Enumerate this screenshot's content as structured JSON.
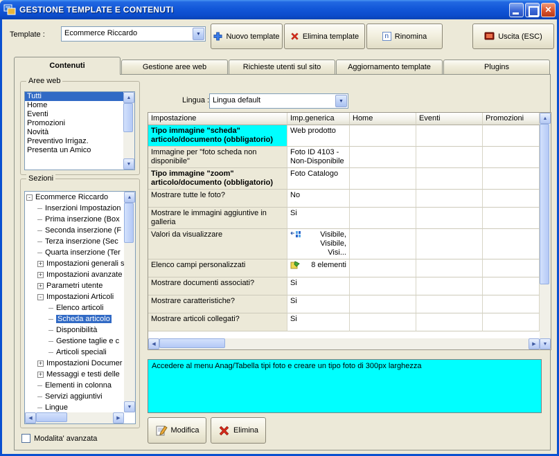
{
  "window": {
    "title": "GESTIONE TEMPLATE E CONTENUTI"
  },
  "toolbar": {
    "template_label": "Template :",
    "template_value": "Ecommerce Riccardo",
    "buttons": {
      "nuovo": "Nuovo template",
      "elimina": "Elimina template",
      "rinomina": "Rinomina",
      "rinomina_icon_letter": "n",
      "uscita": "Uscita (ESC)"
    }
  },
  "tabs": [
    {
      "label": "Contenuti",
      "active": true
    },
    {
      "label": "Gestione aree web"
    },
    {
      "label": "Richieste utenti sul sito"
    },
    {
      "label": "Aggiornamento template"
    },
    {
      "label": "Plugins"
    }
  ],
  "aree_web": {
    "title": "Aree web",
    "selected_index": 0,
    "items": [
      "Tutti",
      "Home",
      "Eventi",
      "Promozioni",
      "Novità",
      "Preventivo Irrigaz.",
      "Presenta un Amico"
    ]
  },
  "sezioni": {
    "title": "Sezioni",
    "items": [
      {
        "label": "Ecommerce Riccardo",
        "level": 0,
        "expander": "minus"
      },
      {
        "label": "Inserzioni Impostazion",
        "level": 1
      },
      {
        "label": "Prima inserzione (Box",
        "level": 1
      },
      {
        "label": "Seconda inserzione (F",
        "level": 1
      },
      {
        "label": "Terza inserzione (Sec",
        "level": 1
      },
      {
        "label": "Quarta inserzione (Ter",
        "level": 1
      },
      {
        "label": "Impostazioni generali s",
        "level": 1,
        "expander": "plus"
      },
      {
        "label": "Impostazioni avanzate",
        "level": 1,
        "expander": "plus"
      },
      {
        "label": "Parametri utente",
        "level": 1,
        "expander": "plus"
      },
      {
        "label": "Impostazioni Articoli",
        "level": 1,
        "expander": "minus"
      },
      {
        "label": "Elenco articoli",
        "level": 2
      },
      {
        "label": "Scheda articolo",
        "level": 2,
        "selected": true
      },
      {
        "label": "Disponibilità",
        "level": 2
      },
      {
        "label": "Gestione taglie e c",
        "level": 2
      },
      {
        "label": "Articoli speciali",
        "level": 2
      },
      {
        "label": "Impostazioni Documer",
        "level": 1,
        "expander": "plus"
      },
      {
        "label": "Messaggi e testi delle",
        "level": 1,
        "expander": "plus"
      },
      {
        "label": "Elementi in colonna",
        "level": 1
      },
      {
        "label": "Servizi aggiuntivi",
        "level": 1
      },
      {
        "label": "Lingue",
        "level": 1
      }
    ]
  },
  "advanced_mode_label": "Modalita' avanzata",
  "lingua": {
    "label": "Lingua :",
    "value": "Lingua default"
  },
  "settings_table": {
    "columns": [
      "Impostazione",
      "Imp.generica",
      "Home",
      "Eventi",
      "Promozioni"
    ],
    "rows": [
      {
        "name": "Tipo immagine \"scheda\" articolo/documento (obbligatorio)",
        "value": "Web prodotto",
        "bold": true,
        "highlight": true
      },
      {
        "name": "Immagine per \"foto scheda non disponibile\"",
        "value": "Foto ID 4103 - Non-Disponibile"
      },
      {
        "name": "Tipo immagine \"zoom\" articolo/documento (obbligatorio)",
        "value": "Foto Catalogo",
        "bold": true
      },
      {
        "name": "Mostrare tutte le foto?",
        "value": "No"
      },
      {
        "name": "Mostrare le immagini aggiuntive in galleria",
        "value": "Si"
      },
      {
        "name": "Valori da visualizzare",
        "value": "Visibile, Visibile, Visi...",
        "icon": "values-icon"
      },
      {
        "name": "Elenco campi personalizzati",
        "value": "8 elementi",
        "icon": "fields-icon"
      },
      {
        "name": "Mostrare documenti associati?",
        "value": "Si"
      },
      {
        "name": "Mostrare caratteristiche?",
        "value": "Si"
      },
      {
        "name": "Mostrare articoli collegati?",
        "value": "Si"
      }
    ]
  },
  "info_box": "Accedere al menu Anag/Tabella tipi foto e creare un tipo foto di 300px larghezza",
  "footer_buttons": {
    "modifica": "Modifica",
    "elimina": "Elimina"
  },
  "colors": {
    "highlight_cyan": "#00ffff",
    "selection_blue": "#316ac5",
    "titlebar_blue": "#0a50d0"
  }
}
